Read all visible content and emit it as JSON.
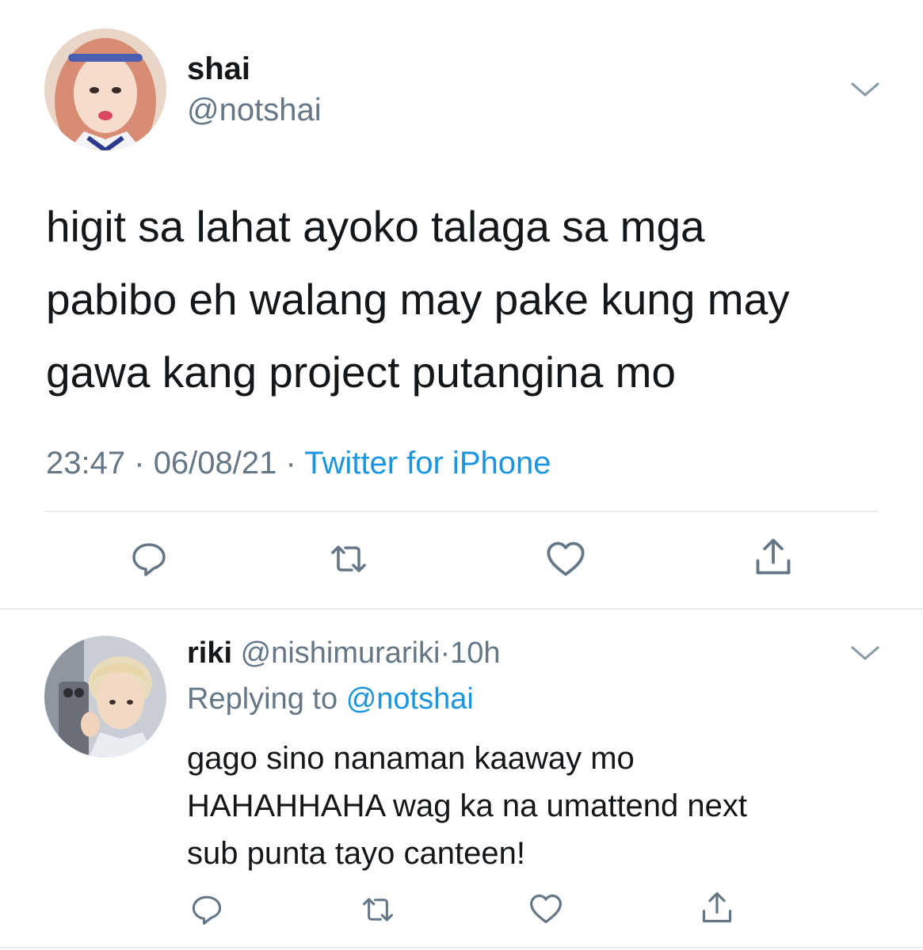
{
  "tweet": {
    "name": "shai",
    "handle": "@notshai",
    "text_lines": [
      "higit sa lahat ayoko talaga sa mga",
      "pabibo eh walang may pake kung may",
      "gawa kang project putangina mo"
    ],
    "time": "23:47",
    "date": "06/08/21",
    "separator": "·",
    "source": "Twitter for iPhone",
    "actions": [
      "reply-icon",
      "retweet-icon",
      "like-icon",
      "share-icon"
    ]
  },
  "reply": {
    "name": "riki",
    "handle": "@nishimurariki",
    "separator": "·",
    "age": "10h",
    "replying_prefix": "Replying to",
    "replying_to": "@notshai",
    "text_lines": [
      "gago sino nanaman kaaway mo",
      "HAHAHHAHA wag ka na umattend next",
      "sub punta tayo canteen!"
    ],
    "actions": [
      "reply-icon",
      "retweet-icon",
      "like-icon",
      "share-icon"
    ]
  },
  "colors": {
    "text": "#14171a",
    "secondary": "#657786",
    "link": "#1b95e0",
    "divider": "#e6ecf0"
  }
}
